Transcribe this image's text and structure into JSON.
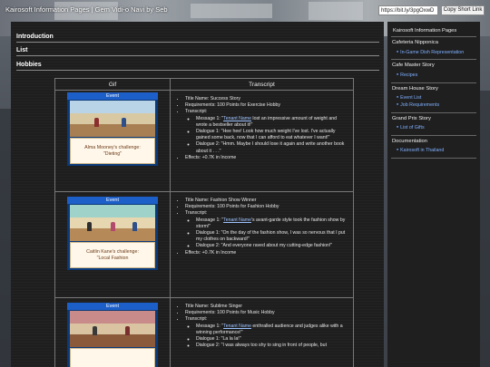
{
  "header": {
    "site_title": "Kairosoft Information Pages | Gem Vidi-o Navi by Seb",
    "short_url_value": "https://bit.ly/3pgOxwD",
    "short_link_button": "Copy Short Link"
  },
  "sections": {
    "introduction": "Introduction",
    "list": "List",
    "hobbies": "Hobbies"
  },
  "table": {
    "col_gif": "Gif",
    "col_transcript": "Transcript",
    "rows": [
      {
        "gif_event": "Event",
        "gif_caption_1": "Alma Mooney's challenge:",
        "gif_caption_2": "\"Dieting\"",
        "title_name": "Title Name: Success Story",
        "requirements": "Requirements: 100 Points for Exercise Hobby",
        "transcript_label": "Transcript:",
        "m1_prefix": "Message 1: \"",
        "m1_tenant": "Tenant Name",
        "m1_text": " lost an impressive amount of weight and wrote a bestseller about it!\"",
        "d1": "Dialogue 1: \"Hee hee! Look how much weight I've lost. I've actually gained some back, now that I can afford to eat whatever I want!\"",
        "d2": "Dialogue 2: \"Hmm. Maybe I should lose it again and write another book about it . . .\"",
        "effects": "Effects: +0.7K in Income"
      },
      {
        "gif_event": "Event",
        "gif_caption_1": "Caitlin Kane's challenge:",
        "gif_caption_2": "\"Local Fashion",
        "title_name": "Title Name: Fashion Show Winner",
        "requirements": "Requirements: 100 Points for Fashion Hobby",
        "transcript_label": "Transcript:",
        "m1_prefix": "Message 1: \"",
        "m1_tenant": "Tenant Name",
        "m1_text": "'s avant-garde style took the fashion show by storm!\"",
        "d1": "Dialogue 1: \"On the day of the fashion show, I was so nervous that I put my clothes on backward!\"",
        "d2": "Dialogue 2: \"And everyone raved about my cutting-edge fashion!\"",
        "effects": "Effects: +0.7K in Income"
      },
      {
        "gif_event": "Event",
        "gif_caption_1": "",
        "gif_caption_2": "",
        "title_name": "Title Name: Sublime Singer",
        "requirements": "Requirements: 100 Points for Music Hobby",
        "transcript_label": "Transcript:",
        "m1_prefix": "Message 1: \"",
        "m1_tenant": "Tenant Name",
        "m1_text": " enthralled audience and judges alike with a winning performance!\"",
        "d1": "Dialogue 1: \"La la la!\"",
        "d2": "Dialogue 2: \"I was always too shy to sing in front of people, but",
        "effects": ""
      }
    ]
  },
  "sidebar": {
    "heading": "Kairosoft Information Pages",
    "groups": [
      {
        "label": "Cafeteria Nipponica",
        "links": [
          "In-Game Dish Representation"
        ]
      },
      {
        "label": "Cafe Master Story",
        "links": [
          "Recipes"
        ]
      },
      {
        "label": "Dream House Story",
        "links": [
          "Event List",
          "Job Requirements"
        ]
      },
      {
        "label": "Grand Prix Story",
        "links": [
          "List of Gifts"
        ]
      },
      {
        "label": "Documentation",
        "links": [
          "Kairosoft in Thailand"
        ]
      }
    ]
  }
}
